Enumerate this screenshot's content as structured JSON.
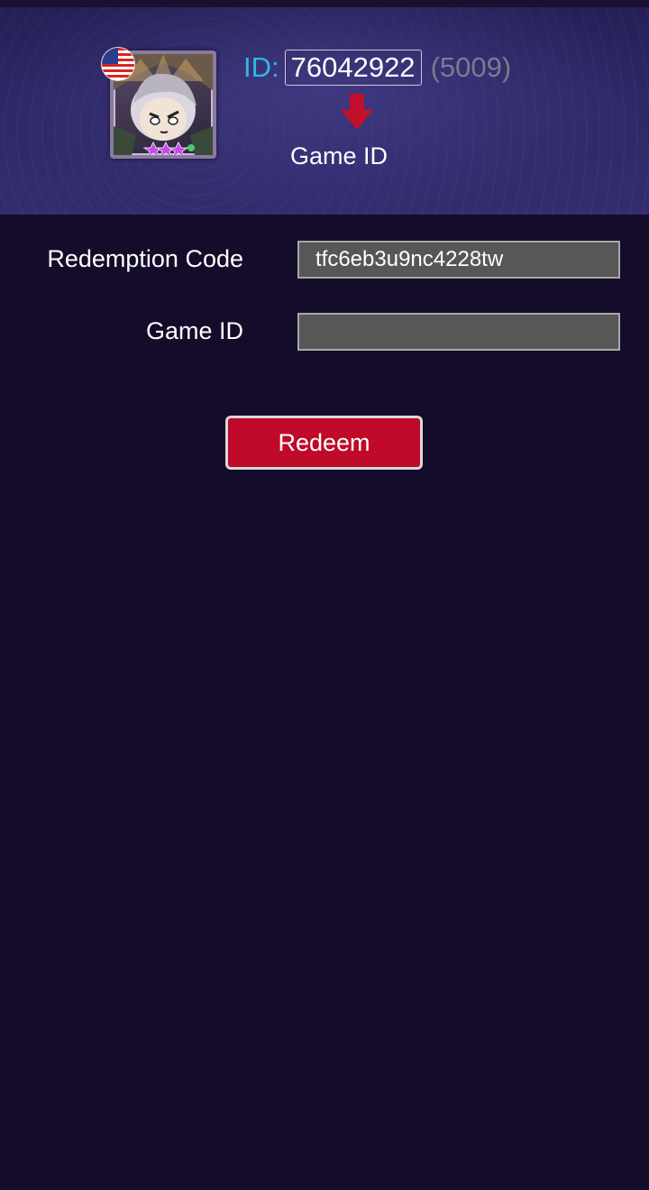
{
  "header": {
    "id_label": "ID:",
    "id_value": "76042922",
    "server": "(5009)",
    "arrow_icon": "down-arrow-icon",
    "caption": "Game ID",
    "flag_icon": "us-flag-icon",
    "accent_color": "#2fb7e8"
  },
  "form": {
    "redemption_label": "Redemption Code",
    "redemption_value": "tfc6eb3u9nc4228tw",
    "game_id_label": "Game ID",
    "game_id_value": "",
    "redeem_label": "Redeem",
    "button_color": "#c00a2a"
  }
}
